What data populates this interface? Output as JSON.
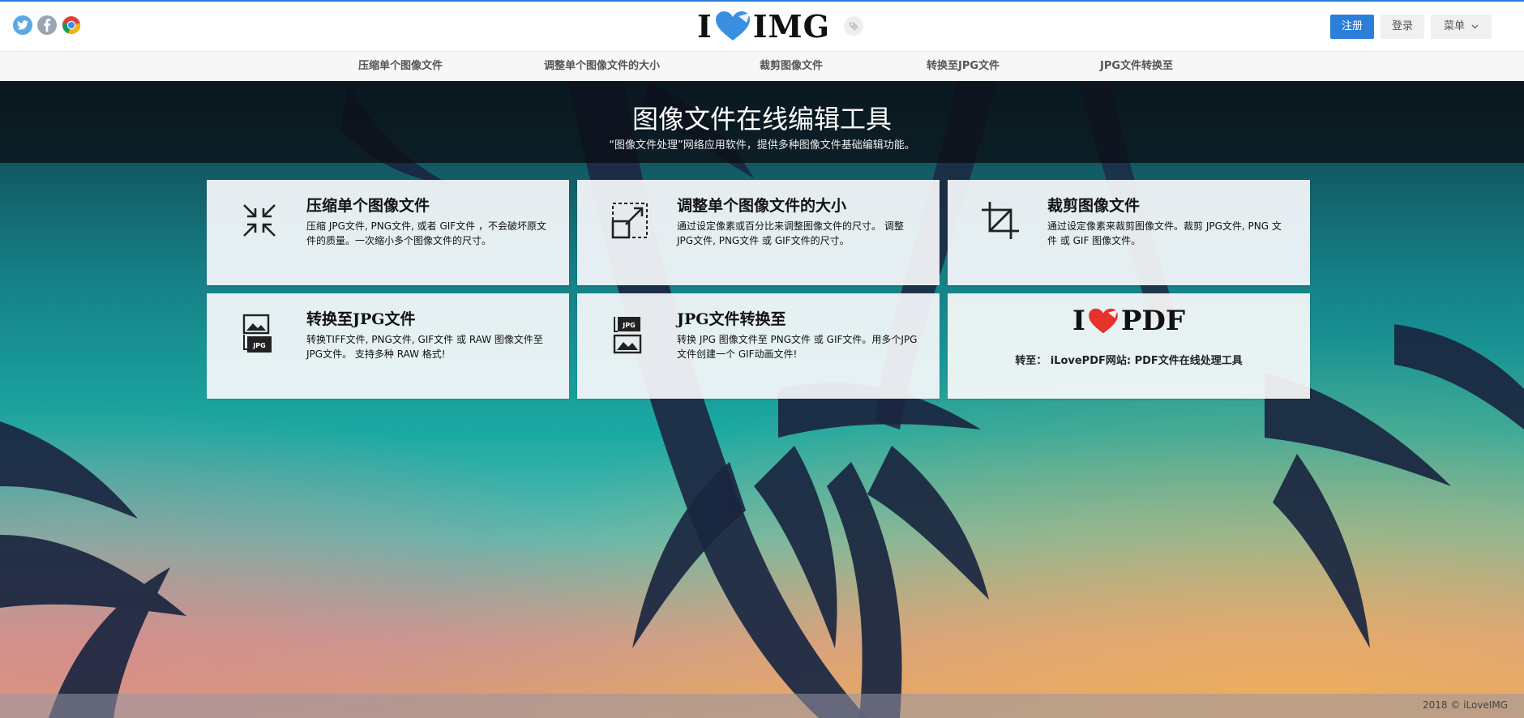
{
  "header": {
    "social": [
      "twitter-icon",
      "facebook-icon",
      "chrome-icon"
    ],
    "logo_left": "I",
    "logo_right": "IMG",
    "signup_label": "注册",
    "login_label": "登录",
    "menu_label": "菜单",
    "accent": "#2b7fd8"
  },
  "nav": {
    "items": [
      "压缩单个图像文件",
      "调整单个图像文件的大小",
      "裁剪图像文件",
      "转换至JPG文件",
      "JPG文件转换至"
    ]
  },
  "hero": {
    "title": "图像文件在线编辑工具",
    "subtitle": "“图像文件处理”网络应用软件，提供多种图像文件基础编辑功能。"
  },
  "cards": [
    {
      "title": "压缩单个图像文件",
      "desc": "压缩 JPG文件, PNG文件, 或者 GIF文件 ，不会破坏原文件的质量。一次缩小多个图像文件的尺寸。",
      "icon": "compress-icon"
    },
    {
      "title": "调整单个图像文件的大小",
      "desc": "通过设定像素或百分比来调整图像文件的尺寸。 调整 JPG文件, PNG文件 或 GIF文件的尺寸。",
      "icon": "resize-icon"
    },
    {
      "title": "裁剪图像文件",
      "desc": "通过设定像素来裁剪图像文件。裁剪 JPG文件, PNG 文件 或 GIF 图像文件。",
      "icon": "crop-icon"
    },
    {
      "title": "转换至JPG文件",
      "desc": "转换TIFF文件, PNG文件, GIF文件 或 RAW 图像文件至 JPG文件。 支持多种 RAW 格式!",
      "icon": "convert-to-jpg-icon"
    },
    {
      "title": "JPG文件转换至",
      "desc": "转换 JPG 图像文件至 PNG文件 或 GIF文件。用多个JPG文件创建一个 GIF动画文件!",
      "icon": "convert-from-jpg-icon"
    }
  ],
  "pdf_card": {
    "logo_left": "I",
    "logo_right": "PDF",
    "text": "转至： iLovePDF网站: PDF文件在线处理工具"
  },
  "footer": {
    "copyright": "2018 © iLoveIMG"
  }
}
